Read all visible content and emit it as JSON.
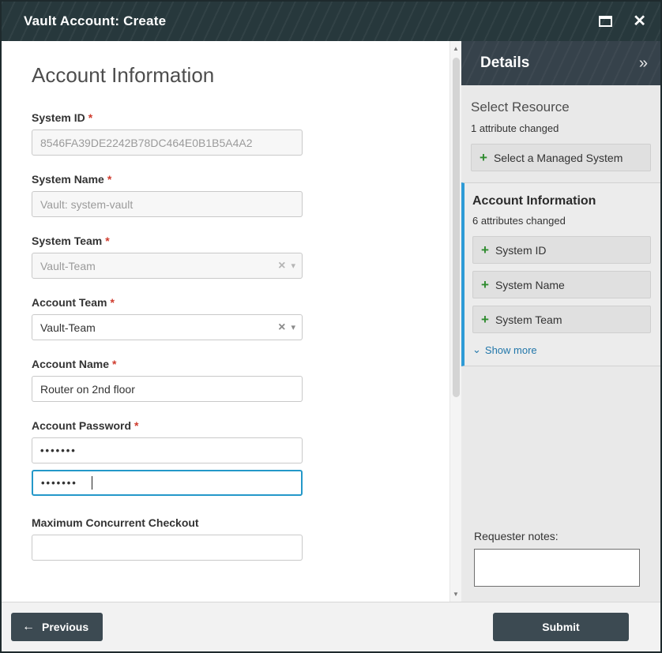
{
  "titlebar": {
    "title": "Vault Account: Create"
  },
  "icons": {
    "close": "✕",
    "collapse": "»",
    "scroll_up": "▲",
    "scroll_down": "▼",
    "clear": "×",
    "caret_down": "▾",
    "plus": "+",
    "show_more_chevron": "⌄",
    "prev_arrow": "←"
  },
  "form": {
    "heading": "Account Information",
    "required_marker": "*",
    "system_id": {
      "label": "System ID",
      "value": "8546FA39DE2242B78DC464E0B1B5A4A2"
    },
    "system_name": {
      "label": "System Name",
      "value": "Vault: system-vault"
    },
    "system_team": {
      "label": "System Team",
      "value": "Vault-Team"
    },
    "account_team": {
      "label": "Account Team",
      "value": "Vault-Team"
    },
    "account_name": {
      "label": "Account Name",
      "value": "Router on 2nd floor"
    },
    "account_password": {
      "label": "Account Password",
      "value": "•••••••",
      "confirm_value": "•••••••"
    },
    "maximum_concurrent_checkout": {
      "label": "Maximum Concurrent Checkout",
      "value": ""
    }
  },
  "details": {
    "title": "Details",
    "select_resource": {
      "heading": "Select Resource",
      "changed": "1 attribute changed",
      "button_label": "Select a Managed System"
    },
    "account_information": {
      "heading": "Account Information",
      "changed": "6 attributes changed",
      "items": [
        "System ID",
        "System Name",
        "System Team"
      ],
      "show_more": "Show more"
    },
    "requester_notes_label": "Requester notes:"
  },
  "footer": {
    "previous_label": "Previous",
    "submit_label": "Submit"
  },
  "colors": {
    "accent_blue": "#2e9bd6",
    "plus_green": "#2e8b2e",
    "focus_border": "#2498c9",
    "titlebar_bg": "#27383c"
  }
}
